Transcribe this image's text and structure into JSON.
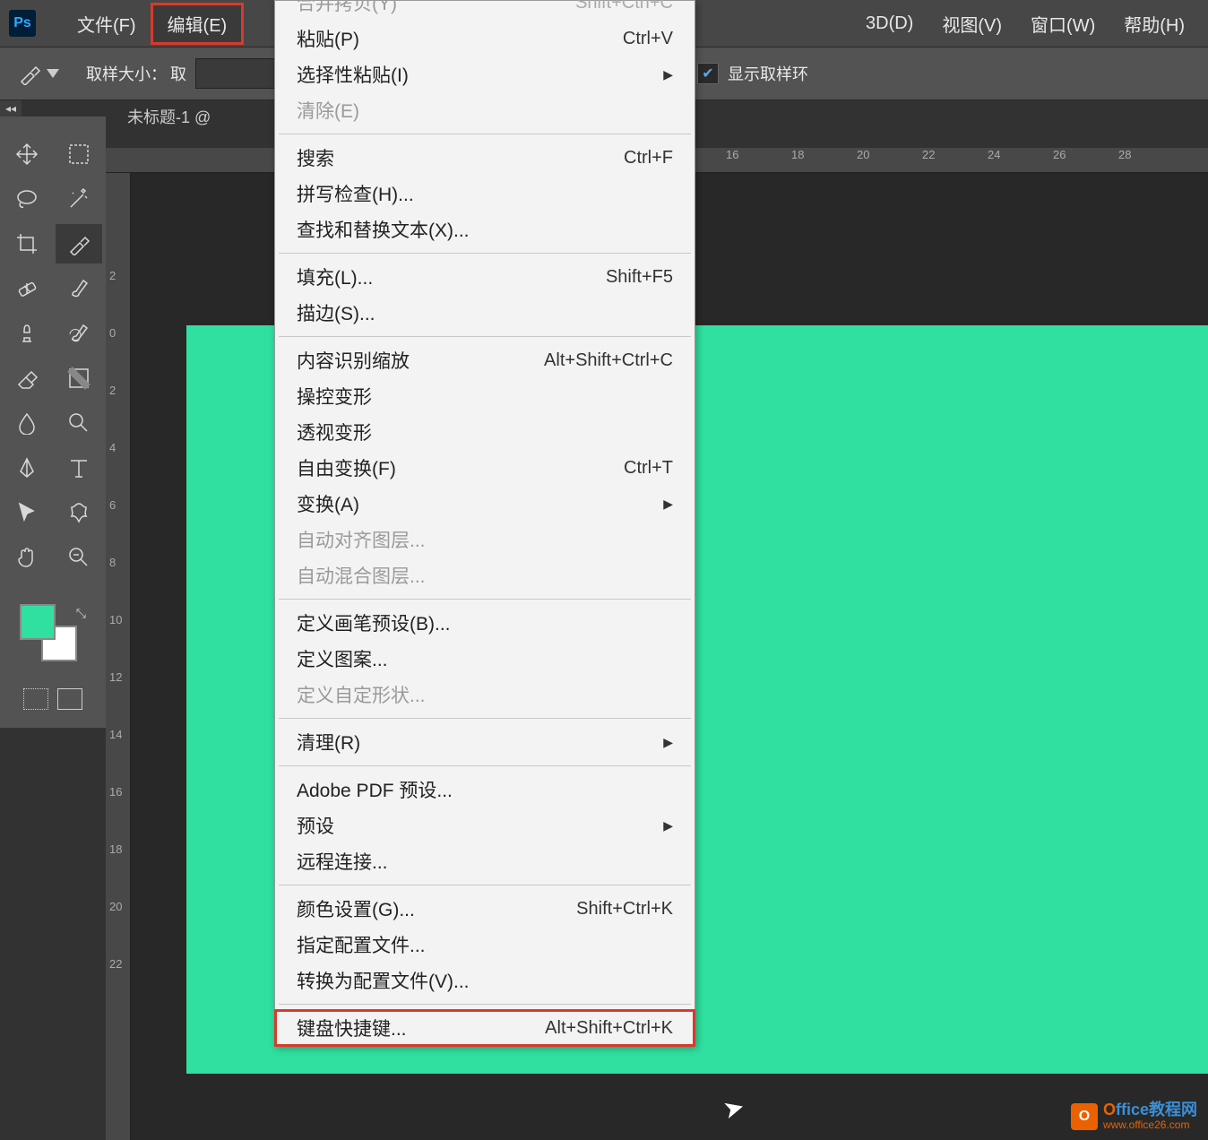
{
  "app_logo": "Ps",
  "menubar": {
    "file": "文件(F)",
    "edit": "编辑(E)",
    "threed": "3D(D)",
    "view": "视图(V)",
    "window": "窗口(W)",
    "help": "帮助(H)"
  },
  "optionsbar": {
    "sample_size_label": "取样大小：",
    "sample_partial": "取",
    "show_ring_label": "显示取样环"
  },
  "document": {
    "tab_title": "未标题-1 @"
  },
  "ruler_h": [
    "16",
    "18",
    "20",
    "22",
    "24",
    "26",
    "28"
  ],
  "ruler_v": [
    "2",
    "0",
    "2",
    "4",
    "6",
    "8",
    "10",
    "12",
    "14",
    "16",
    "18",
    "20",
    "22"
  ],
  "dropdown": {
    "items": [
      {
        "label": "合并拷贝(Y)",
        "shortcut": "Shift+Ctrl+C",
        "disabled": true,
        "cutTop": true
      },
      {
        "label": "粘贴(P)",
        "shortcut": "Ctrl+V"
      },
      {
        "label": "选择性粘贴(I)",
        "arrow": true
      },
      {
        "label": "清除(E)",
        "disabled": true
      },
      {
        "sep": true
      },
      {
        "label": "搜索",
        "shortcut": "Ctrl+F"
      },
      {
        "label": "拼写检查(H)..."
      },
      {
        "label": "查找和替换文本(X)..."
      },
      {
        "sep": true
      },
      {
        "label": "填充(L)...",
        "shortcut": "Shift+F5"
      },
      {
        "label": "描边(S)..."
      },
      {
        "sep": true
      },
      {
        "label": "内容识别缩放",
        "shortcut": "Alt+Shift+Ctrl+C"
      },
      {
        "label": "操控变形"
      },
      {
        "label": "透视变形"
      },
      {
        "label": "自由变换(F)",
        "shortcut": "Ctrl+T"
      },
      {
        "label": "变换(A)",
        "arrow": true
      },
      {
        "label": "自动对齐图层...",
        "disabled": true
      },
      {
        "label": "自动混合图层...",
        "disabled": true
      },
      {
        "sep": true
      },
      {
        "label": "定义画笔预设(B)..."
      },
      {
        "label": "定义图案..."
      },
      {
        "label": "定义自定形状...",
        "disabled": true
      },
      {
        "sep": true
      },
      {
        "label": "清理(R)",
        "arrow": true
      },
      {
        "sep": true
      },
      {
        "label": "Adobe PDF 预设..."
      },
      {
        "label": "预设",
        "arrow": true
      },
      {
        "label": "远程连接..."
      },
      {
        "sep": true
      },
      {
        "label": "颜色设置(G)...",
        "shortcut": "Shift+Ctrl+K"
      },
      {
        "label": "指定配置文件..."
      },
      {
        "label": "转换为配置文件(V)..."
      },
      {
        "sep": true
      },
      {
        "label": "键盘快捷键...",
        "shortcut": "Alt+Shift+Ctrl+K",
        "highlighted": true
      }
    ]
  },
  "watermark": {
    "icon_letter": "O",
    "brand_o": "O",
    "brand_rest": "ffice教程网",
    "url": "www.office26.com"
  },
  "colors": {
    "foreground": "#30e0a0",
    "background": "#ffffff",
    "canvas_fill": "#30e0a0"
  }
}
